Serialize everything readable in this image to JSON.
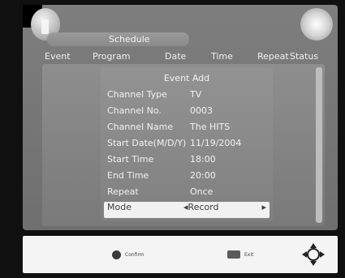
{
  "header": {
    "title": "Schedule"
  },
  "columns": [
    "Event",
    "Program",
    "Date",
    "Time",
    "Repeat",
    "Status"
  ],
  "dialog": {
    "title": "Event Add",
    "fields": [
      {
        "label": "Channel Type",
        "value": "TV"
      },
      {
        "label": "Channel No.",
        "value": "0003"
      },
      {
        "label": "Channel Name",
        "value": "The HITS"
      },
      {
        "label": "Start Date(M/D/Y)",
        "value": "11/19/2004"
      },
      {
        "label": "Start Time",
        "value": "18:00"
      },
      {
        "label": "End Time",
        "value": "20:00"
      },
      {
        "label": "Repeat",
        "value": "Once"
      },
      {
        "label": "Mode",
        "value": "Record"
      }
    ],
    "selected_field": "Mode"
  },
  "footer": {
    "confirm_label": "Confirm",
    "exit_label": "Exit"
  },
  "colors": {
    "screen_bg": "#7e7e7e",
    "footer_bg": "#f4f4f4",
    "selected_row_bg": "#f1f1f1"
  },
  "icons": [
    "logo-left-icon",
    "logo-right-icon",
    "confirm-button-icon",
    "exit-button-icon",
    "dpad-icon",
    "left-arrow-icon",
    "right-arrow-icon"
  ]
}
